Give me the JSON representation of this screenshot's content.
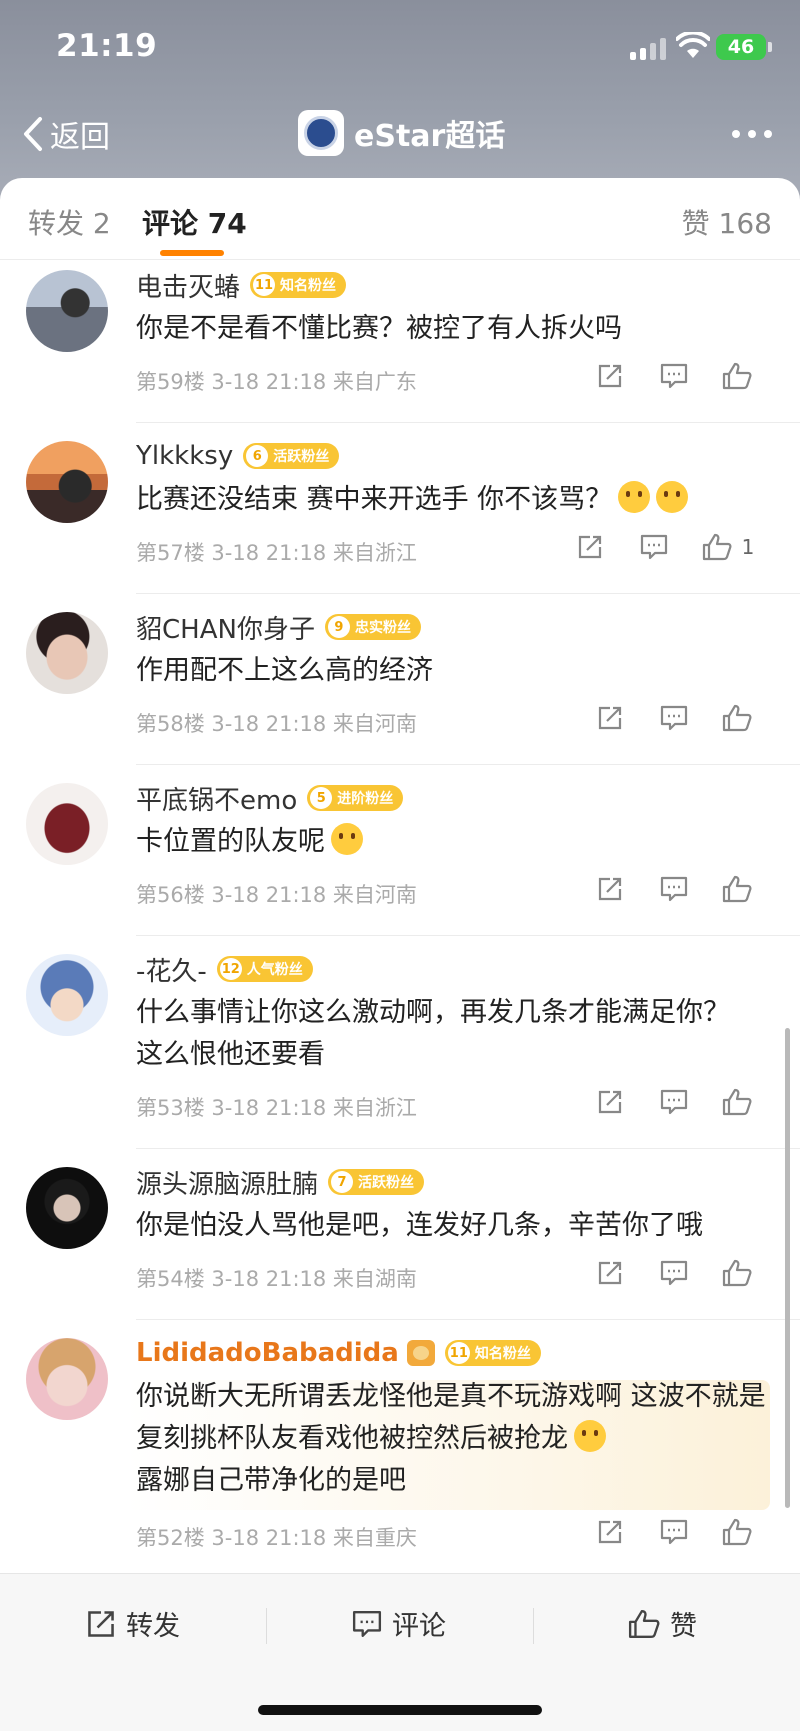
{
  "status": {
    "time": "21:19",
    "battery": "46"
  },
  "nav": {
    "back_label": "返回",
    "title": "eStar超话"
  },
  "tabs": {
    "forward": "转发 2",
    "comment": "评论 74",
    "like": "赞 168"
  },
  "comments": [
    {
      "user": "电击灭蝽",
      "level": "11",
      "badge": "知名粉丝",
      "text": "你是不是看不懂比赛？被控了有人拆火吗",
      "meta": "第59楼 3-18 21:18 来自广东",
      "likes": ""
    },
    {
      "user": "Ylkkksy",
      "level": "6",
      "badge": "活跃粉丝",
      "text": "比赛还没结束 赛中来开选手 你不该骂？",
      "meta": "第57楼 3-18 21:18 来自浙江",
      "likes": "1"
    },
    {
      "user": "貂CHAN你身子",
      "level": "9",
      "badge": "忠实粉丝",
      "text": "作用配不上这么高的经济",
      "meta": "第58楼 3-18 21:18 来自河南",
      "likes": ""
    },
    {
      "user": "平底锅不emo",
      "level": "5",
      "badge": "进阶粉丝",
      "text": "卡位置的队友呢",
      "meta": "第56楼 3-18 21:18 来自河南",
      "likes": ""
    },
    {
      "user": "-花久-",
      "level": "12",
      "badge": "人气粉丝",
      "text": "什么事情让你这么激动啊，再发几条才能满足你？这么恨他还要看",
      "meta": "第53楼 3-18 21:18 来自浙江",
      "likes": ""
    },
    {
      "user": "源头源脑源肚腩",
      "level": "7",
      "badge": "活跃粉丝",
      "text": "你是怕没人骂他是吧，连发好几条，辛苦你了哦",
      "meta": "第54楼 3-18 21:18 来自湖南",
      "likes": ""
    },
    {
      "user": "LididadoBabadida",
      "level": "11",
      "badge": "知名粉丝",
      "text": "你说断大无所谓丢龙怪他是真不玩游戏啊 这波不就是复刻挑杯队友看戏他被控然后被抢龙",
      "text2": "露娜自己带净化的是吧",
      "meta": "第52楼 3-18 21:18 来自重庆",
      "likes": ""
    }
  ],
  "bottom": {
    "forward": "转发",
    "comment": "评论",
    "like": "赞"
  },
  "colors": {
    "accent": "#ff8200",
    "badge": "#f9c534",
    "vip_name": "#e8771a",
    "battery": "#3ec94d"
  }
}
